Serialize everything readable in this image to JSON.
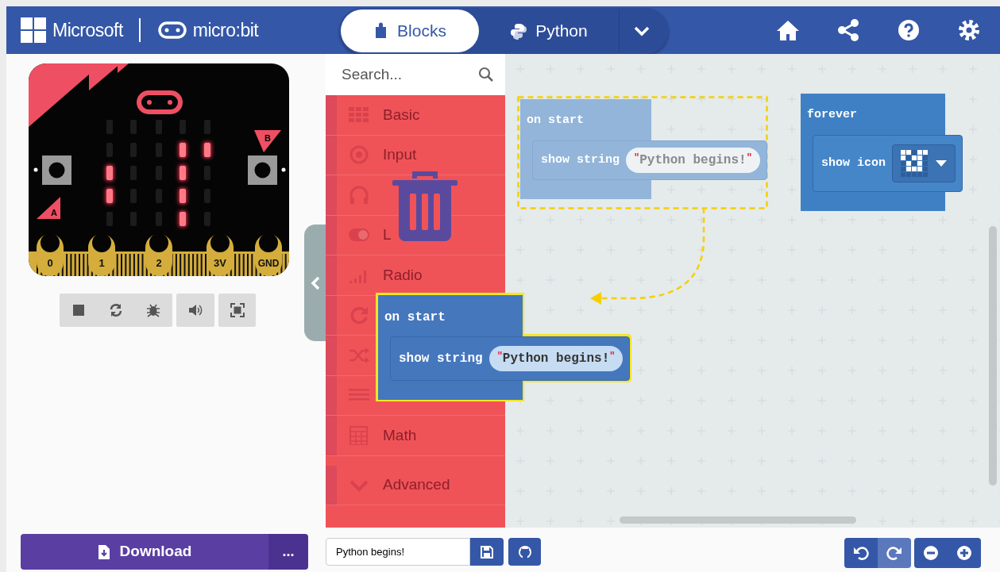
{
  "header": {
    "brand": "Microsoft",
    "product": "micro:bit",
    "tabs": [
      {
        "label": "Blocks",
        "selected": true
      },
      {
        "label": "Python",
        "selected": false
      }
    ]
  },
  "simulator": {
    "leds": [
      [
        false,
        false,
        false,
        false,
        false
      ],
      [
        false,
        false,
        false,
        true,
        true
      ],
      [
        true,
        false,
        false,
        true,
        false
      ],
      [
        true,
        false,
        false,
        true,
        false
      ],
      [
        false,
        false,
        false,
        true,
        false
      ]
    ],
    "buttons": [
      "A",
      "B"
    ],
    "pins": [
      "0",
      "1",
      "2",
      "3V",
      "GND"
    ]
  },
  "download": {
    "label": "Download",
    "more": "..."
  },
  "toolbox": {
    "search_placeholder": "Search...",
    "categories": [
      {
        "kind": "grid",
        "label": "Basic"
      },
      {
        "kind": "target",
        "label": "Input"
      },
      {
        "kind": "headphones"
      },
      {
        "kind": "toggle",
        "label": "L"
      },
      {
        "kind": "bars",
        "label": "Radio"
      },
      {
        "kind": "loop"
      },
      {
        "kind": "shuffle"
      },
      {
        "kind": "lines"
      },
      {
        "kind": "calculator",
        "label": "Math"
      },
      {
        "kind": "chevron",
        "label": "Advanced"
      }
    ]
  },
  "workspace": {
    "blocks": [
      {
        "ghost": true,
        "dragging": false,
        "label": "on start",
        "statement": {
          "kind": "string",
          "label": "show string",
          "quote_open": "\"",
          "value": "Python begins!",
          "quote_close": "\""
        }
      },
      {
        "ghost": false,
        "dragging": false,
        "label": "forever",
        "statement": {
          "kind": "icon",
          "label": "show icon"
        }
      },
      {
        "ghost": false,
        "dragging": true,
        "label": "on start",
        "statement": {
          "kind": "string",
          "label": "show string",
          "quote_open": "\"",
          "value": "Python begins!",
          "quote_close": "\""
        }
      }
    ]
  },
  "project": {
    "name": "Python begins!"
  },
  "editor_buttons": [
    {
      "kind": "undo",
      "disabled": false
    },
    {
      "kind": "redo",
      "disabled": true
    },
    {
      "kind": "zoom_out",
      "disabled": false
    },
    {
      "kind": "zoom_in",
      "disabled": false
    }
  ]
}
